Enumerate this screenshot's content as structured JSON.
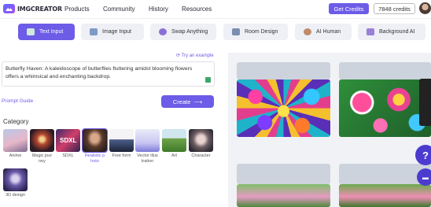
{
  "header": {
    "logo_text": "IMGCREATOR",
    "nav": [
      "Products",
      "Community",
      "History",
      "Resources"
    ],
    "get_credits": "Get Credits",
    "credits": "7848 credits"
  },
  "tabs": [
    {
      "label": "Text Input",
      "active": true
    },
    {
      "label": "Image Input"
    },
    {
      "label": "Swap Anything"
    },
    {
      "label": "Room Design"
    },
    {
      "label": "AI Human"
    },
    {
      "label": "Background AI"
    }
  ],
  "prompt": {
    "try_example": "Try an example",
    "text": "Butterfly Haven: A kaleidoscope of butterflies fluttering amidst blooming flowers offers a whimsical and enchanting backdrop.",
    "guide": "Prompt Guide",
    "create": "Create",
    "create_arrow": "⟶"
  },
  "category": {
    "title": "Category",
    "items": [
      {
        "label": "Anime"
      },
      {
        "label": "Magic jour ney"
      },
      {
        "label": "SDXL"
      },
      {
        "label": "Realistic p hoto",
        "selected": true
      },
      {
        "label": "Free form"
      },
      {
        "label": "Vector illus tration"
      },
      {
        "label": "Art"
      },
      {
        "label": "Character"
      },
      {
        "label": "3D design"
      }
    ]
  },
  "thumbs": {
    "sdxl_overlay": "SDXL"
  },
  "fab": {
    "help": "?",
    "chat": "▬"
  },
  "colors": {
    "accent": "#6c5ce7",
    "tab_bg": "#eef0f6"
  }
}
